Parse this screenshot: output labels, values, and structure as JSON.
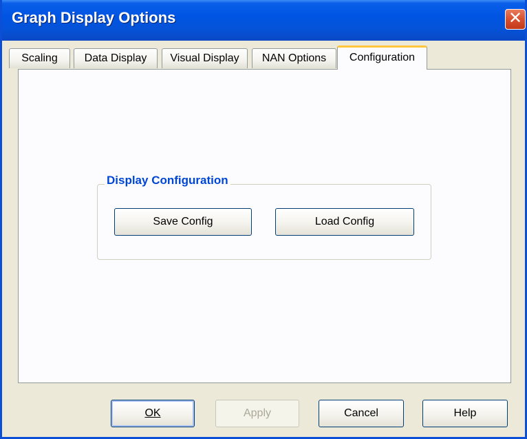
{
  "window": {
    "title": "Graph Display Options",
    "close_glyph": "✕"
  },
  "tabs": [
    {
      "label": "Scaling",
      "selected": false
    },
    {
      "label": "Data Display",
      "selected": false
    },
    {
      "label": "Visual Display",
      "selected": false
    },
    {
      "label": "NAN Options",
      "selected": false
    },
    {
      "label": "Configuration",
      "selected": true
    }
  ],
  "group": {
    "label": "Display Configuration",
    "save_label": "Save Config",
    "load_label": "Load Config"
  },
  "footer": {
    "ok_label": "OK",
    "apply_label": "Apply",
    "apply_enabled": false,
    "cancel_label": "Cancel",
    "help_label": "Help"
  },
  "colors": {
    "title_bar": "#0054e3",
    "close_button": "#d7502f",
    "group_label": "#0046d5",
    "active_tab_highlight": "#ffc83c",
    "dialog_background": "#ece9d8"
  }
}
